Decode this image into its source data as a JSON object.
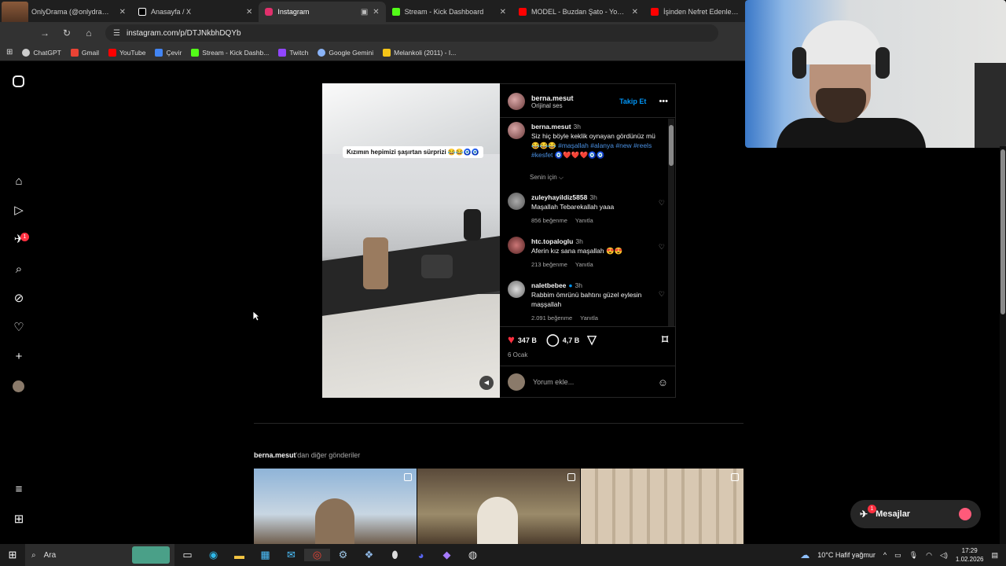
{
  "browser": {
    "tabs": [
      {
        "title": "OnlyDrama (@onlydramaX) / X",
        "fav_color": "#ffffff"
      },
      {
        "title": "Anasayfa / X",
        "fav_color": "#ffffff"
      },
      {
        "title": "Instagram",
        "fav_color": "#e1306c",
        "active": true
      },
      {
        "title": "Stream - Kick Dashboard",
        "fav_color": "#53fc18"
      },
      {
        "title": "MODEL - Buzdan Şato - YouTube",
        "fav_color": "#ff0000"
      },
      {
        "title": "İşinden Nefret Edenlere ÖZEL",
        "fav_color": "#ff0000"
      }
    ],
    "url": "instagram.com/p/DTJNkbhDQYb",
    "bookmarks": [
      {
        "label": "ChatGPT",
        "color": "#cccccc"
      },
      {
        "label": "Gmail",
        "color": "#ea4335"
      },
      {
        "label": "YouTube",
        "color": "#ff0000"
      },
      {
        "label": "Çevir",
        "color": "#4285f4"
      },
      {
        "label": "Stream - Kick Dashb...",
        "color": "#53fc18"
      },
      {
        "label": "Twitch",
        "color": "#9146ff"
      },
      {
        "label": "Google Gemini",
        "color": "#8ab4f8"
      },
      {
        "label": "Melankoli (2011) - I...",
        "color": "#f5c518"
      }
    ]
  },
  "sidebar": {
    "notification_count": "1"
  },
  "post": {
    "username": "berna.mesut",
    "audio": "Orijinal ses",
    "follow_label": "Takip Et",
    "media_caption": "Kızımın hepimizi şaşırtan sürprizi 😂😂🧿🧿",
    "caption": {
      "user": "berna.mesut",
      "time": "3h",
      "text": "Siz hiç böyle keklik oynayan gördünüz mü 😂😂😂 ",
      "hashtags": "#maşallah #alanya #new #reels #kesfet",
      "emoji_tail": " 🧿❤️❤️❤️🧿🧿"
    },
    "for_you_label": "Senin için ⌵",
    "comments": [
      {
        "user": "zuleyhayildiz5858",
        "time": "3h",
        "text": "Maşallah Tebarekallah yaaa",
        "likes": "856 beğenme",
        "reply": "Yanıtla"
      },
      {
        "user": "htc.topaloglu",
        "time": "3h",
        "text": "Aferin kız sana maşallah 😍😍",
        "likes": "213 beğenme",
        "reply": "Yanıtla"
      },
      {
        "user": "naletbebee",
        "time": "3h",
        "text": "Rabbim ömrünü bahtını güzel eylesin maşşallah",
        "likes": "2.091 beğenme",
        "reply": "Yanıtla",
        "verified": true
      }
    ],
    "like_count": "347 B",
    "comment_count": "4,7 B",
    "date": "6 Ocak",
    "comment_placeholder": "Yorum ekle..."
  },
  "more_posts": {
    "user": "berna.mesut",
    "suffix": "'dan diğer gönderiler"
  },
  "messages": {
    "label": "Mesajlar",
    "count": "1"
  },
  "taskbar": {
    "search": "Ara",
    "weather": "10°C  Hafif yağmur",
    "time": "17:29",
    "date": "1.02.2026"
  }
}
